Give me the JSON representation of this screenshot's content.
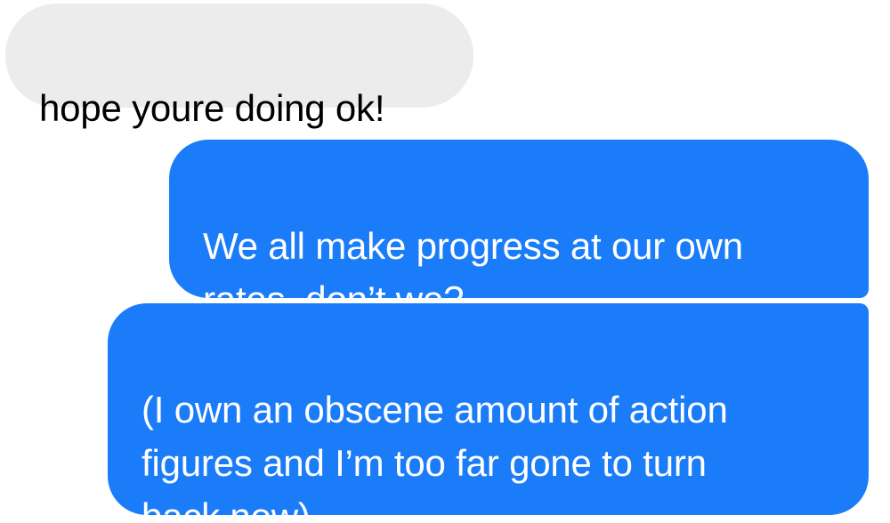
{
  "messages": {
    "incoming": [
      {
        "text": "hope youre doing ok!"
      }
    ],
    "outgoing": [
      {
        "text": "We all make progress at our own\nrates, don’t we?"
      },
      {
        "text": "(I own an obscene amount of action\nfigures and I’m too far gone to turn\nback now)"
      }
    ]
  },
  "colors": {
    "incoming_bubble": "#ececec",
    "outgoing_bubble": "#1a7cf8",
    "incoming_text": "#000000",
    "outgoing_text": "#ffffff"
  }
}
